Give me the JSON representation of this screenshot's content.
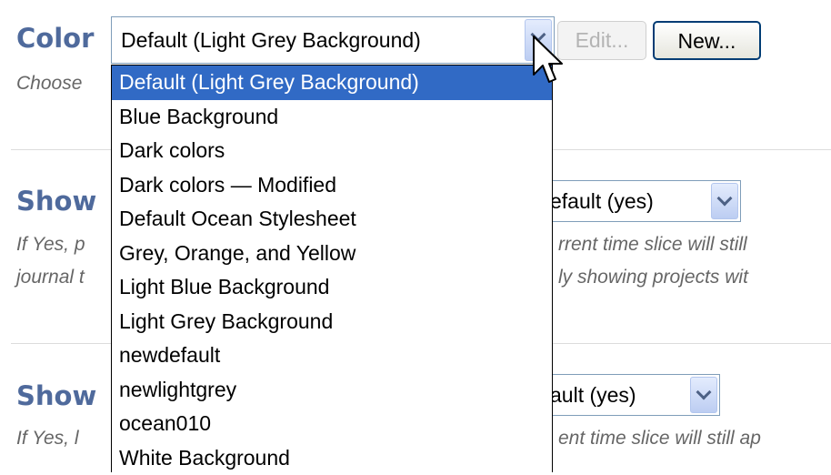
{
  "color_pref": {
    "label": "Color",
    "selected": "Default (Light Grey Background)",
    "hint": "Choose",
    "edit_button": "Edit...",
    "new_button": "New...",
    "options": [
      "Default (Light Grey Background)",
      "Blue Background",
      "Dark colors",
      "Dark colors — Modified",
      "Default Ocean Stylesheet",
      "Grey, Orange, and Yellow",
      "Light Blue Background",
      "Light Grey Background",
      "newdefault",
      "newlightgrey",
      "ocean010",
      "White Background"
    ],
    "highlighted_index": 0
  },
  "pref_2": {
    "label": "Show",
    "select_value": "efault (yes)",
    "hint_line1_left": "If Yes, p",
    "hint_line1_right": "rrent time slice will still",
    "hint_line2_left": "journal t",
    "hint_line2_right": "ly showing projects wit"
  },
  "pref_3": {
    "label": "Show",
    "select_value": "ault (yes)",
    "hint_line1_left": "If Yes, l",
    "hint_line1_right": "ent time slice will still ap"
  }
}
